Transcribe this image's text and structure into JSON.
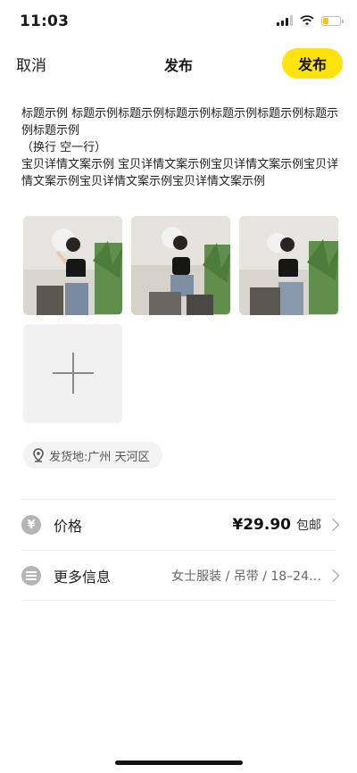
{
  "status": {
    "time": "11:03"
  },
  "nav": {
    "cancel": "取消",
    "title": "发布",
    "publish": "发布"
  },
  "description": "标题示例 标题示例标题示例标题示例标题示例标题示例标题示例标题示例\n（换行 空一行）\n宝贝详情文案示例 宝贝详情文案示例宝贝详情文案示例宝贝详情文案示例宝贝详情文案示例宝贝详情文案示例",
  "photos": [
    {
      "name": "product-photo-1"
    },
    {
      "name": "product-photo-2"
    },
    {
      "name": "product-photo-3"
    }
  ],
  "location": {
    "label": "发货地:广州 天河区"
  },
  "price_row": {
    "icon": "¥",
    "label": "价格",
    "price": "¥29.90",
    "shipping": "包邮"
  },
  "more_row": {
    "label": "更多信息",
    "value": "女士服装 / 吊带 / 18–24…"
  },
  "colors": {
    "accent": "#ffe30f",
    "battery": "#f5c518"
  }
}
